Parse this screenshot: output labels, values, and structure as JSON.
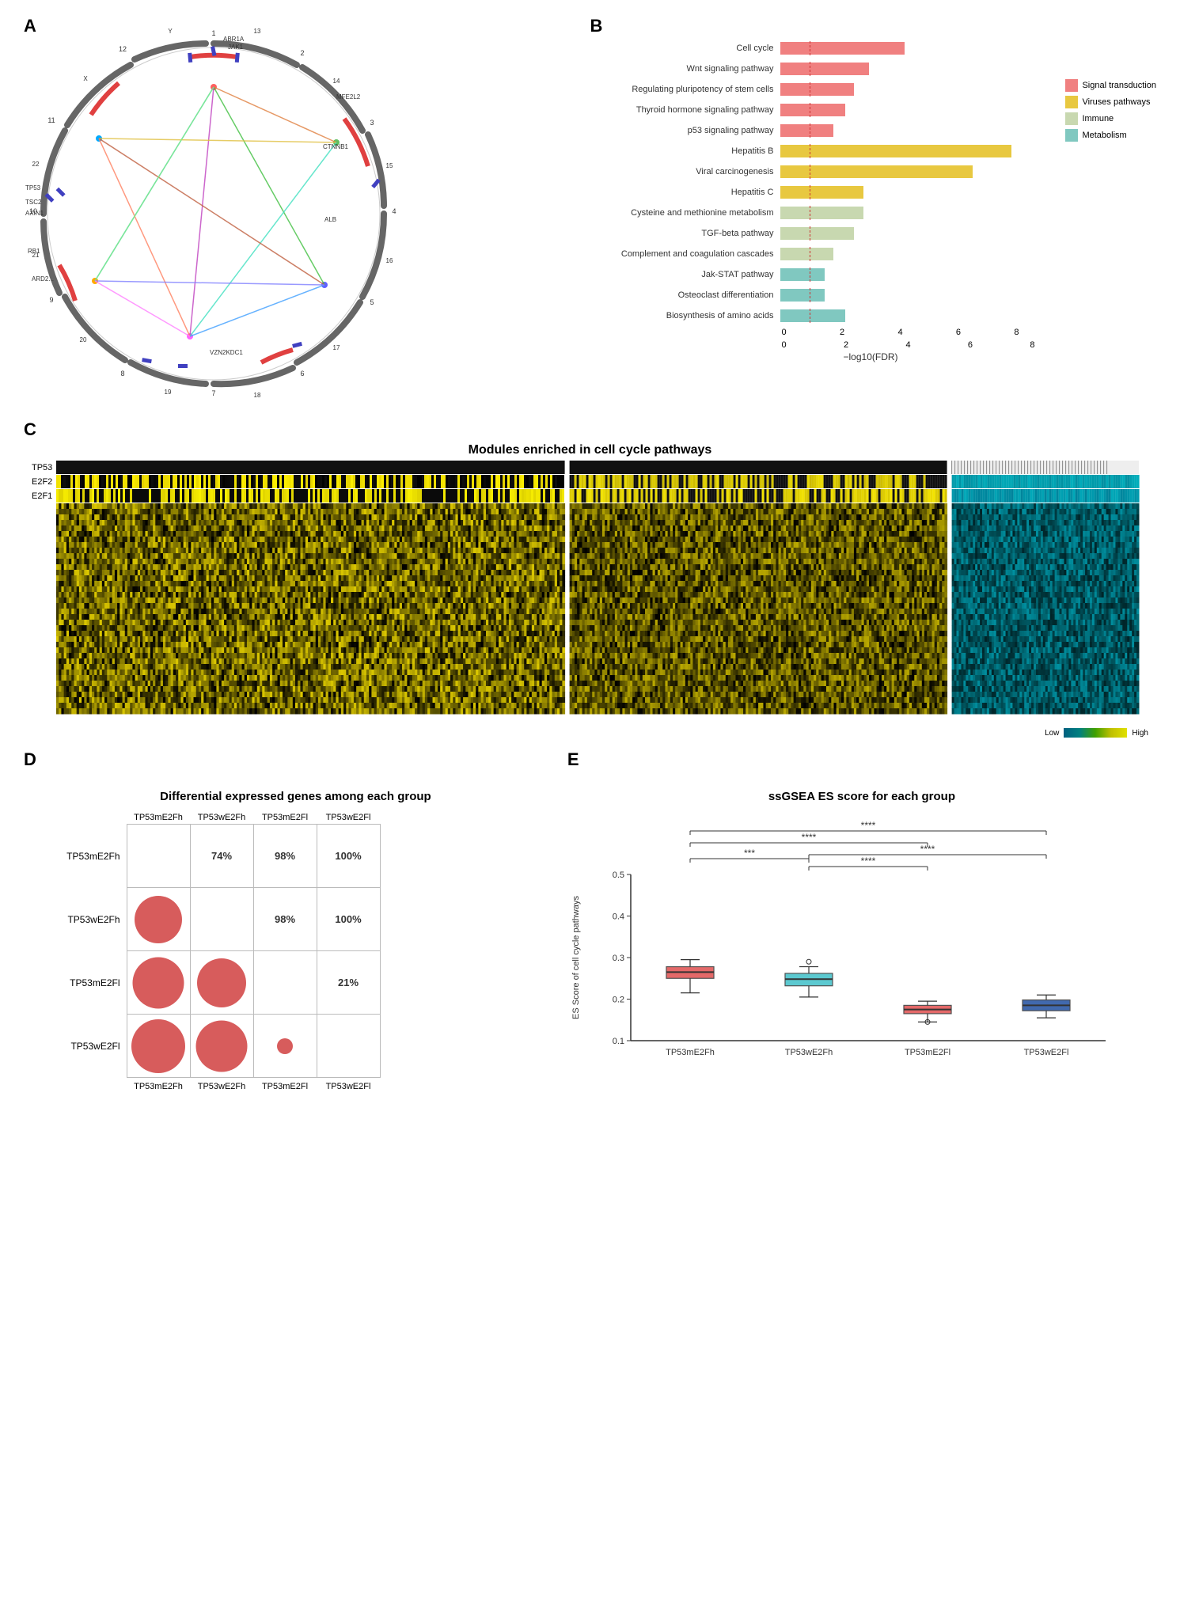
{
  "panels": {
    "a_label": "A",
    "b_label": "B",
    "c_label": "C",
    "d_label": "D",
    "e_label": "E"
  },
  "panel_b": {
    "x_axis_label": "−log10(FDR)",
    "bars": [
      {
        "label": "Cell cycle",
        "value": 4.2,
        "max": 8,
        "color": "#f08080",
        "category": "Signal transduction"
      },
      {
        "label": "Wnt signaling pathway",
        "value": 3.0,
        "max": 8,
        "color": "#f08080",
        "category": "Signal transduction"
      },
      {
        "label": "Regulating pluripotency of stem cells",
        "value": 2.5,
        "max": 8,
        "color": "#f08080",
        "category": "Signal transduction"
      },
      {
        "label": "Thyroid hormone signaling pathway",
        "value": 2.2,
        "max": 8,
        "color": "#f08080",
        "category": "Signal transduction"
      },
      {
        "label": "p53 signaling pathway",
        "value": 1.8,
        "max": 8,
        "color": "#f08080",
        "category": "Signal transduction"
      },
      {
        "label": "Hepatitis B",
        "value": 7.8,
        "max": 8,
        "color": "#e8c840",
        "category": "Viruses pathways"
      },
      {
        "label": "Viral carcinogenesis",
        "value": 6.5,
        "max": 8,
        "color": "#e8c840",
        "category": "Viruses pathways"
      },
      {
        "label": "Hepatitis C",
        "value": 2.8,
        "max": 8,
        "color": "#e8c840",
        "category": "Viruses pathways"
      },
      {
        "label": "Cysteine and methionine metabolism",
        "value": 2.8,
        "max": 8,
        "color": "#c8d8b0",
        "category": "Immune"
      },
      {
        "label": "TGF-beta pathway",
        "value": 2.5,
        "max": 8,
        "color": "#c8d8b0",
        "category": "Immune"
      },
      {
        "label": "Complement and coagulation cascades",
        "value": 1.8,
        "max": 8,
        "color": "#c8d8b0",
        "category": "Immune"
      },
      {
        "label": "Jak-STAT pathway",
        "value": 1.5,
        "max": 8,
        "color": "#80c8c0",
        "category": "Metabolism"
      },
      {
        "label": "Osteoclast differentiation",
        "value": 1.5,
        "max": 8,
        "color": "#80c8c0",
        "category": "Metabolism"
      },
      {
        "label": "Biosynthesis of amino acids",
        "value": 2.2,
        "max": 8,
        "color": "#80c8c0",
        "category": "Metabolism"
      }
    ],
    "legend": [
      {
        "label": "Signal transduction",
        "color": "#f08080"
      },
      {
        "label": "Viruses pathways",
        "color": "#e8c840"
      },
      {
        "label": "Immune",
        "color": "#c8d8b0"
      },
      {
        "label": "Metabolism",
        "color": "#80c8c0"
      }
    ],
    "dashed_x": 1,
    "x_ticks": [
      "0",
      "2",
      "4",
      "6",
      "8"
    ]
  },
  "panel_c": {
    "title": "Modules enriched in cell cycle pathways",
    "row_labels": [
      "TP53",
      "E2F2",
      "E2F1"
    ],
    "color_scale_low": "Low",
    "color_scale_high": "High"
  },
  "panel_d": {
    "title": "Differential expressed genes among each group",
    "row_labels": [
      "TP53mE2Fh",
      "TP53wE2Fh",
      "TP53mE2Fl",
      "TP53wE2Fl"
    ],
    "col_labels": [
      "TP53mE2Fh",
      "TP53wE2Fh",
      "TP53mE2Fl",
      "TP53wE2Fl"
    ],
    "cells": [
      [
        null,
        "74%",
        "98%",
        "100%"
      ],
      [
        "large",
        null,
        "98%",
        "100%"
      ],
      [
        "large",
        "large",
        null,
        "21%"
      ],
      [
        "large",
        "large",
        "small",
        null
      ]
    ],
    "dot_sizes": [
      [
        0,
        0,
        0,
        0
      ],
      [
        60,
        0,
        0,
        0
      ],
      [
        65,
        62,
        0,
        0
      ],
      [
        68,
        65,
        20,
        0
      ]
    ]
  },
  "panel_e": {
    "title": "ssGSEA ES score for each group",
    "y_axis_label": "ES Score of cell cycle pathways",
    "x_labels": [
      "TP53mE2Fh",
      "TP53wE2Fh",
      "TP53mE2Fl",
      "TP53wE2Fl"
    ],
    "significance_labels": [
      "***",
      "****",
      "****",
      "****"
    ],
    "y_min": 0.1,
    "y_max": 0.5,
    "boxes": [
      {
        "median": 0.265,
        "q1": 0.25,
        "q3": 0.278,
        "min": 0.215,
        "max": 0.295,
        "color": "#e05050",
        "outliers": []
      },
      {
        "median": 0.248,
        "q1": 0.232,
        "q3": 0.262,
        "min": 0.205,
        "max": 0.278,
        "color": "#40c0c8",
        "outliers": [
          0.29
        ]
      },
      {
        "median": 0.175,
        "q1": 0.165,
        "q3": 0.185,
        "min": 0.145,
        "max": 0.195,
        "color": "#e05050",
        "outliers": [
          0.145
        ]
      },
      {
        "median": 0.185,
        "q1": 0.172,
        "q3": 0.198,
        "min": 0.155,
        "max": 0.21,
        "color": "#2050a0",
        "outliers": []
      }
    ]
  }
}
